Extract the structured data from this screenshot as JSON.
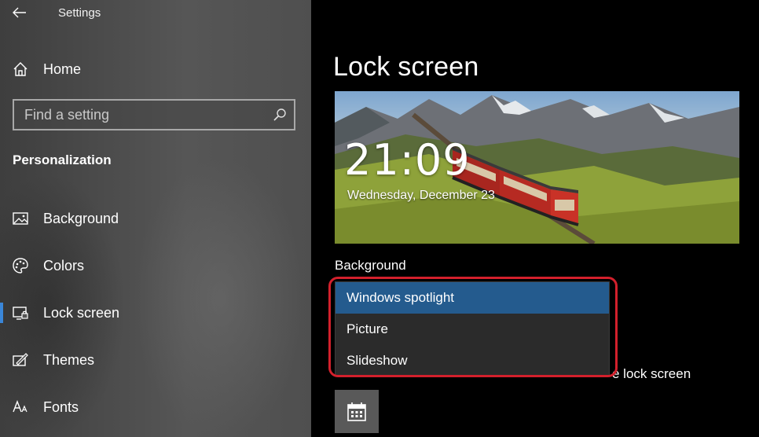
{
  "window": {
    "title": "Settings"
  },
  "sidebar": {
    "home_label": "Home",
    "search": {
      "placeholder": "Find a setting"
    },
    "section_title": "Personalization",
    "items": [
      {
        "label": "Background",
        "icon": "image-icon"
      },
      {
        "label": "Colors",
        "icon": "palette-icon"
      },
      {
        "label": "Lock screen",
        "icon": "lock-screen-icon",
        "active": true
      },
      {
        "label": "Themes",
        "icon": "themes-icon"
      },
      {
        "label": "Fonts",
        "icon": "fonts-icon"
      }
    ]
  },
  "main": {
    "page_title": "Lock screen",
    "preview": {
      "time": "21:09",
      "date": "Wednesday, December 23"
    },
    "background_label": "Background",
    "background_dropdown": {
      "options": [
        "Windows spotlight",
        "Picture",
        "Slideshow"
      ],
      "selected": "Windows spotlight"
    },
    "partial_text": "e lock screen"
  },
  "colors": {
    "accent": "#245b8e",
    "highlight_ring": "#d3202c",
    "active_indicator": "#3a86d8"
  }
}
